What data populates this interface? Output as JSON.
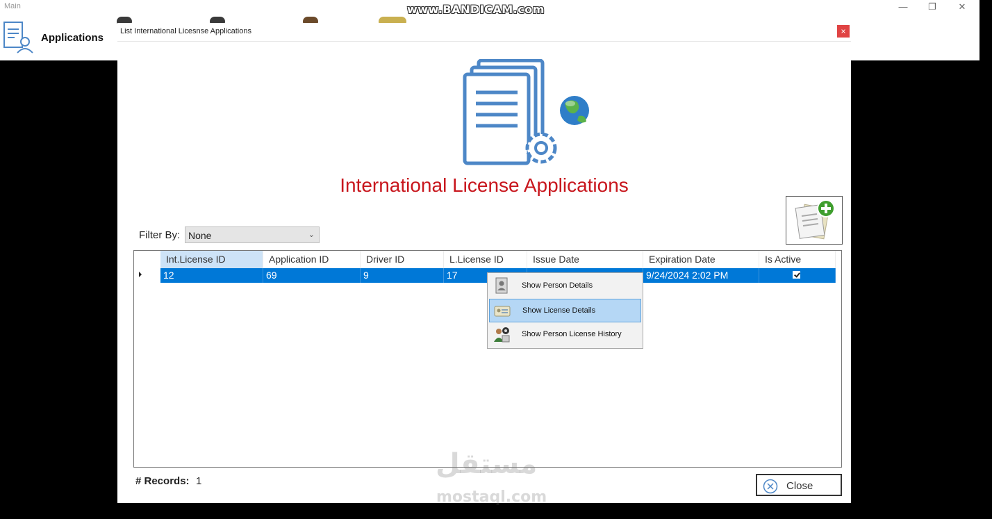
{
  "main_window": {
    "title": "Main",
    "toolbar_item_label": "Applications",
    "controls": {
      "minimize": "—",
      "maximize": "❐",
      "close": "✕"
    }
  },
  "recording_watermark": "www.BANDICAM.com",
  "dialog": {
    "title": "List International Licesnse Applications",
    "close_glyph": "×",
    "heading": "International License Applications",
    "filter": {
      "label": "Filter By:",
      "value": "None",
      "chevron": "⌄"
    },
    "grid": {
      "columns": [
        "Int.License ID",
        "Application ID",
        "Driver ID",
        "L.License ID",
        "Issue Date",
        "Expiration Date",
        "Is Active"
      ],
      "rows": [
        {
          "int_license_id": "12",
          "application_id": "69",
          "driver_id": "9",
          "l_license_id": "17",
          "issue_date": "",
          "expiration_date": "9/24/2024 2:02 PM",
          "is_active": true
        }
      ]
    },
    "context_menu": {
      "items": [
        {
          "label": "Show Person Details",
          "icon": "person-card-icon"
        },
        {
          "label": "Show License Details",
          "icon": "license-card-icon",
          "highlighted": true
        },
        {
          "label": "Show Person License History",
          "icon": "person-history-icon"
        }
      ]
    },
    "records": {
      "label": "# Records:",
      "value": "1"
    },
    "close_button": {
      "label": "Close"
    }
  },
  "site_watermark": {
    "arabic": "مستقل",
    "latin": "mostaql.com"
  },
  "colors": {
    "heading": "#c8161d",
    "selection": "#0078d7",
    "menu_highlight": "#b5d7f5"
  }
}
